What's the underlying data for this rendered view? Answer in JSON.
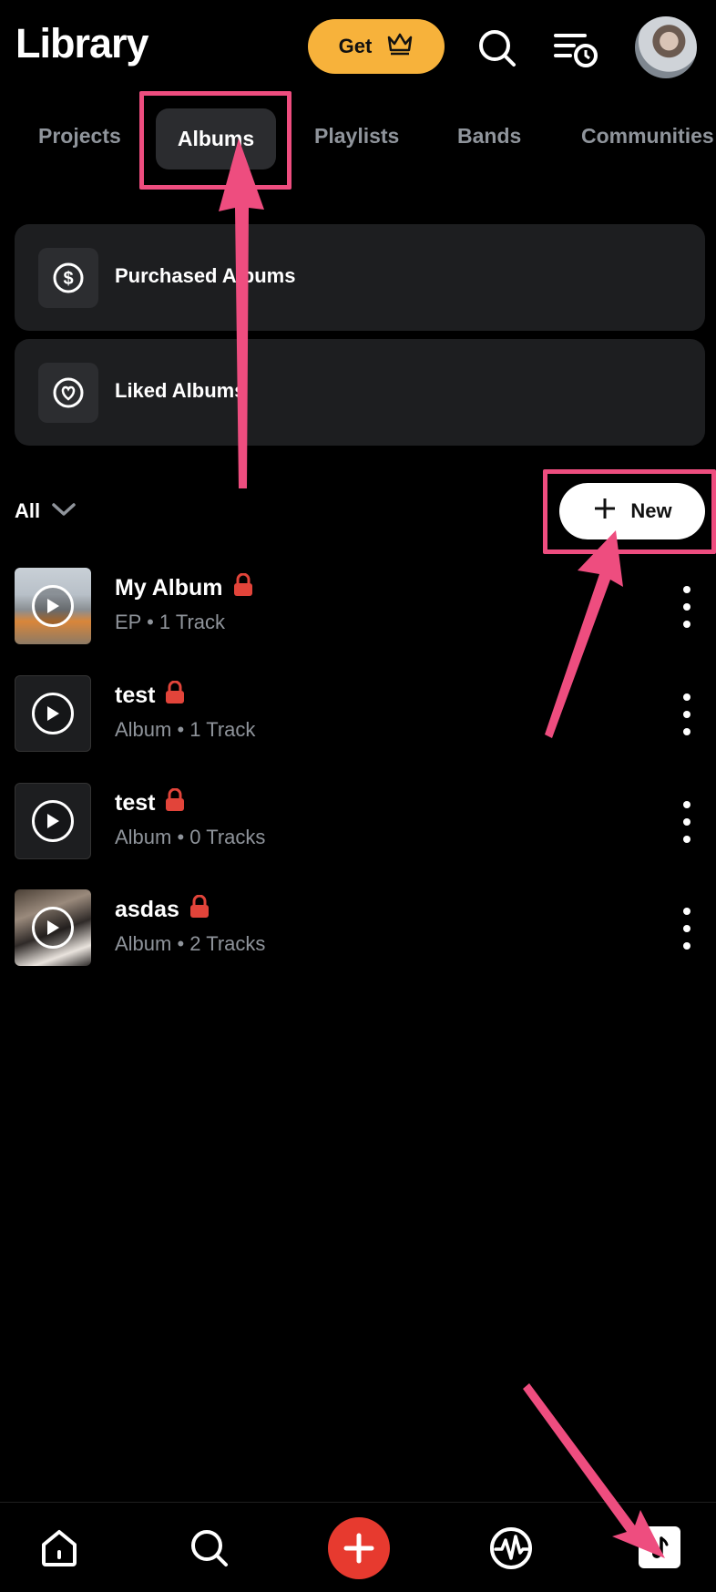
{
  "header": {
    "title": "Library",
    "get_label": "Get"
  },
  "tabs": [
    {
      "label": "Projects"
    },
    {
      "label": "Albums",
      "active": true
    },
    {
      "label": "Playlists"
    },
    {
      "label": "Bands"
    },
    {
      "label": "Communities"
    }
  ],
  "cards": [
    {
      "label": "Purchased Albums",
      "icon": "dollar-icon"
    },
    {
      "label": "Liked Albums",
      "icon": "heart-icon"
    }
  ],
  "filter": {
    "label": "All"
  },
  "new_button": {
    "label": "New"
  },
  "albums": [
    {
      "title": "My Album",
      "subtitle": "EP • 1 Track",
      "locked": true,
      "thumb": "photo1"
    },
    {
      "title": "test",
      "subtitle": "Album • 1 Track",
      "locked": true,
      "thumb": "plain"
    },
    {
      "title": "test",
      "subtitle": "Album • 0 Tracks",
      "locked": true,
      "thumb": "plain"
    },
    {
      "title": "asdas",
      "subtitle": "Album • 2 Tracks",
      "locked": true,
      "thumb": "photo2"
    }
  ],
  "colors": {
    "accent_gold": "#f7b23b",
    "lock_red": "#e2443a",
    "annotation_pink": "#ee4d7f",
    "add_red": "#e73a2f"
  },
  "nav": [
    "home-icon",
    "search-icon",
    "add-icon",
    "waveform-icon",
    "library-icon"
  ]
}
